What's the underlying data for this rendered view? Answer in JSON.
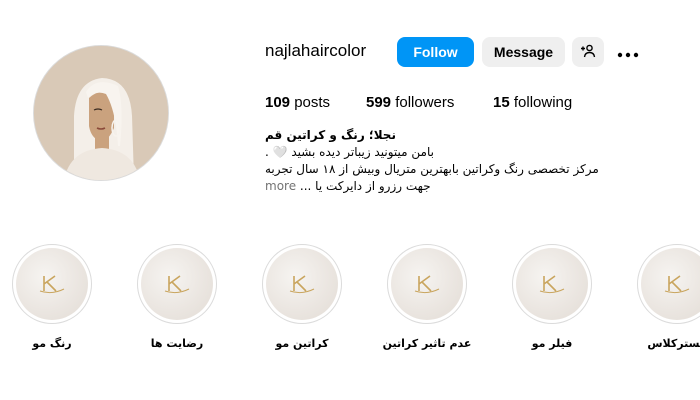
{
  "profile": {
    "username": "najlahaircolor",
    "buttons": {
      "follow": "Follow",
      "message": "Message"
    },
    "stats": {
      "posts_count": "109",
      "posts_label": "posts",
      "followers_count": "599",
      "followers_label": "followers",
      "following_count": "15",
      "following_label": "following"
    },
    "bio": {
      "name": "نجلا؛ رنگ و کراتین قم",
      "line1": "بامن میتونید زیباتر دیده بشید 🤍 .",
      "line2": "مرکز تخصصی رنگ وکراتین بابهترین متریال وبیش از ۱۸ سال تجربه",
      "line3": "جهت رزرو از دایرکت یا ...",
      "more": "more"
    }
  },
  "highlights": [
    {
      "label": "رنگ مو"
    },
    {
      "label": "رضایت ها"
    },
    {
      "label": "کراتین مو"
    },
    {
      "label": "عدم تاثیر کراتین"
    },
    {
      "label": "فیلر مو"
    },
    {
      "label": "مسترکلاس"
    }
  ],
  "colors": {
    "accent": "#0095f6",
    "button_gray": "#efefef",
    "avatar_bg": "#d9c9b7",
    "muted_text": "#737373"
  },
  "icons": {
    "suggest": "person-plus-icon",
    "more": "ellipsis-icon",
    "highlight": "k-monogram-logo"
  }
}
